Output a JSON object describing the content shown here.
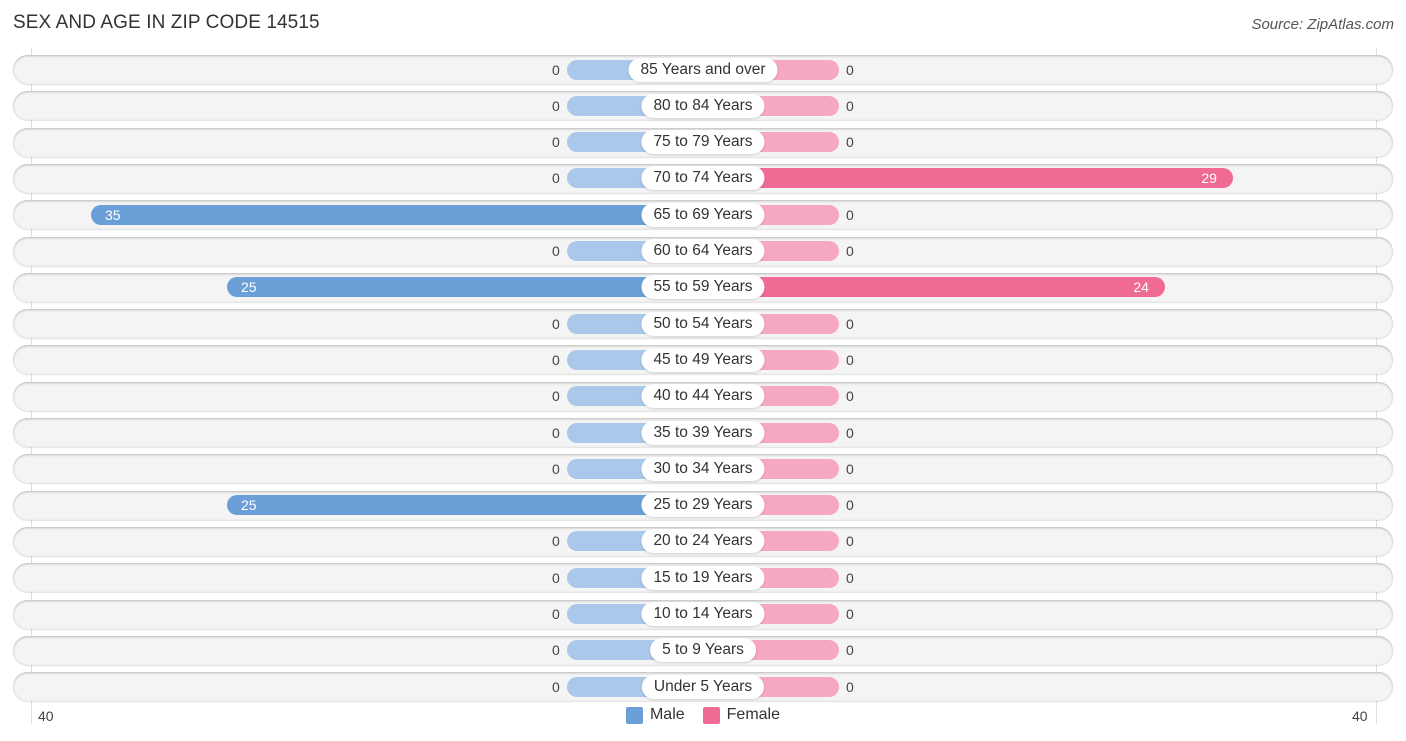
{
  "header": {
    "title": "SEX AND AGE IN ZIP CODE 14515",
    "source": "Source: ZipAtlas.com"
  },
  "colors": {
    "male_strong": "#6a9fd8",
    "male_light": "#a9c8ea",
    "female_strong": "#f06b93",
    "female_light": "#f5a8c0"
  },
  "chart_data": {
    "type": "bar",
    "orientation": "horizontal-diverging",
    "title": "SEX AND AGE IN ZIP CODE 14515",
    "xlim": [
      -40,
      40
    ],
    "tick_labels": {
      "left": "40",
      "right": "40"
    },
    "legend": {
      "position": "bottom-center",
      "entries": [
        "Male",
        "Female"
      ]
    },
    "categories": [
      "85 Years and over",
      "80 to 84 Years",
      "75 to 79 Years",
      "70 to 74 Years",
      "65 to 69 Years",
      "60 to 64 Years",
      "55 to 59 Years",
      "50 to 54 Years",
      "45 to 49 Years",
      "40 to 44 Years",
      "35 to 39 Years",
      "30 to 34 Years",
      "25 to 29 Years",
      "20 to 24 Years",
      "15 to 19 Years",
      "10 to 14 Years",
      "5 to 9 Years",
      "Under 5 Years"
    ],
    "series": [
      {
        "name": "Male",
        "values": [
          0,
          0,
          0,
          0,
          35,
          0,
          25,
          0,
          0,
          0,
          0,
          0,
          25,
          0,
          0,
          0,
          0,
          0
        ]
      },
      {
        "name": "Female",
        "values": [
          0,
          0,
          0,
          29,
          0,
          0,
          24,
          0,
          0,
          0,
          0,
          0,
          0,
          0,
          0,
          0,
          0,
          0
        ]
      }
    ]
  }
}
